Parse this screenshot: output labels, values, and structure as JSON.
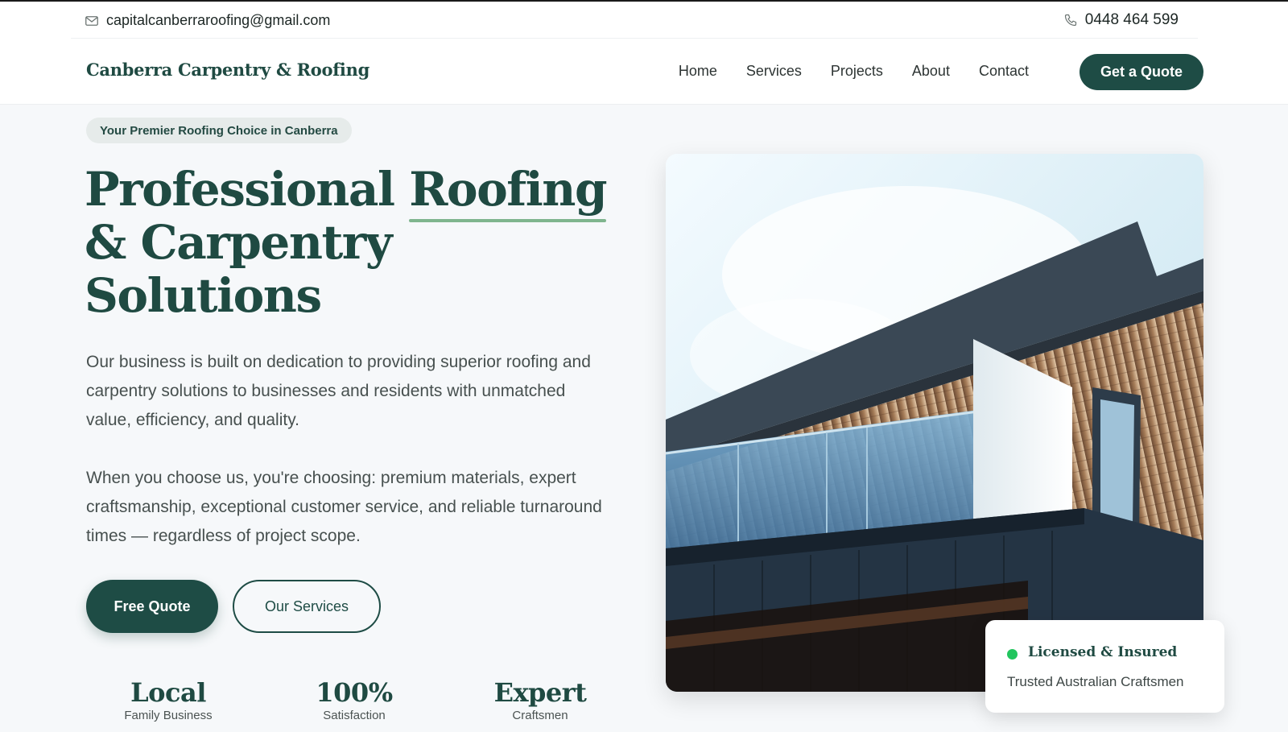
{
  "topbar": {
    "email": "capitalcanberraroofing@gmail.com",
    "phone": "0448 464 599"
  },
  "nav": {
    "brand": "Canberra Carpentry & Roofing",
    "links": [
      "Home",
      "Services",
      "Projects",
      "About",
      "Contact"
    ],
    "cta": "Get a Quote"
  },
  "hero": {
    "badge": "Your Premier Roofing Choice in Canberra",
    "title_part1": "Professional ",
    "title_highlight": "Roofing",
    "title_part2": "& Carpentry",
    "title_part3": "Solutions",
    "paragraph1": "Our business is built on dedication to providing superior roofing and carpentry solutions to businesses and residents with unmatched value, efficiency, and quality.",
    "paragraph2": "When you choose us, you're choosing: premium materials, expert craftsmanship, exceptional customer service, and reliable turnaround times — regardless of project scope.",
    "primary_button": "Free Quote",
    "secondary_button": "Our Services"
  },
  "stats": [
    {
      "value": "Local",
      "label": "Family Business"
    },
    {
      "value": "100%",
      "label": "Satisfaction"
    },
    {
      "value": "Expert",
      "label": "Craftsmen"
    }
  ],
  "card": {
    "title": "Licensed & Insured",
    "subtitle": "Trusted Australian Craftsmen"
  },
  "colors": {
    "brand": "#1e4c45",
    "accent_underline": "#7fb58e",
    "status_dot": "#22c55e"
  },
  "icons": {
    "email": "mail-icon",
    "phone": "phone-icon"
  }
}
